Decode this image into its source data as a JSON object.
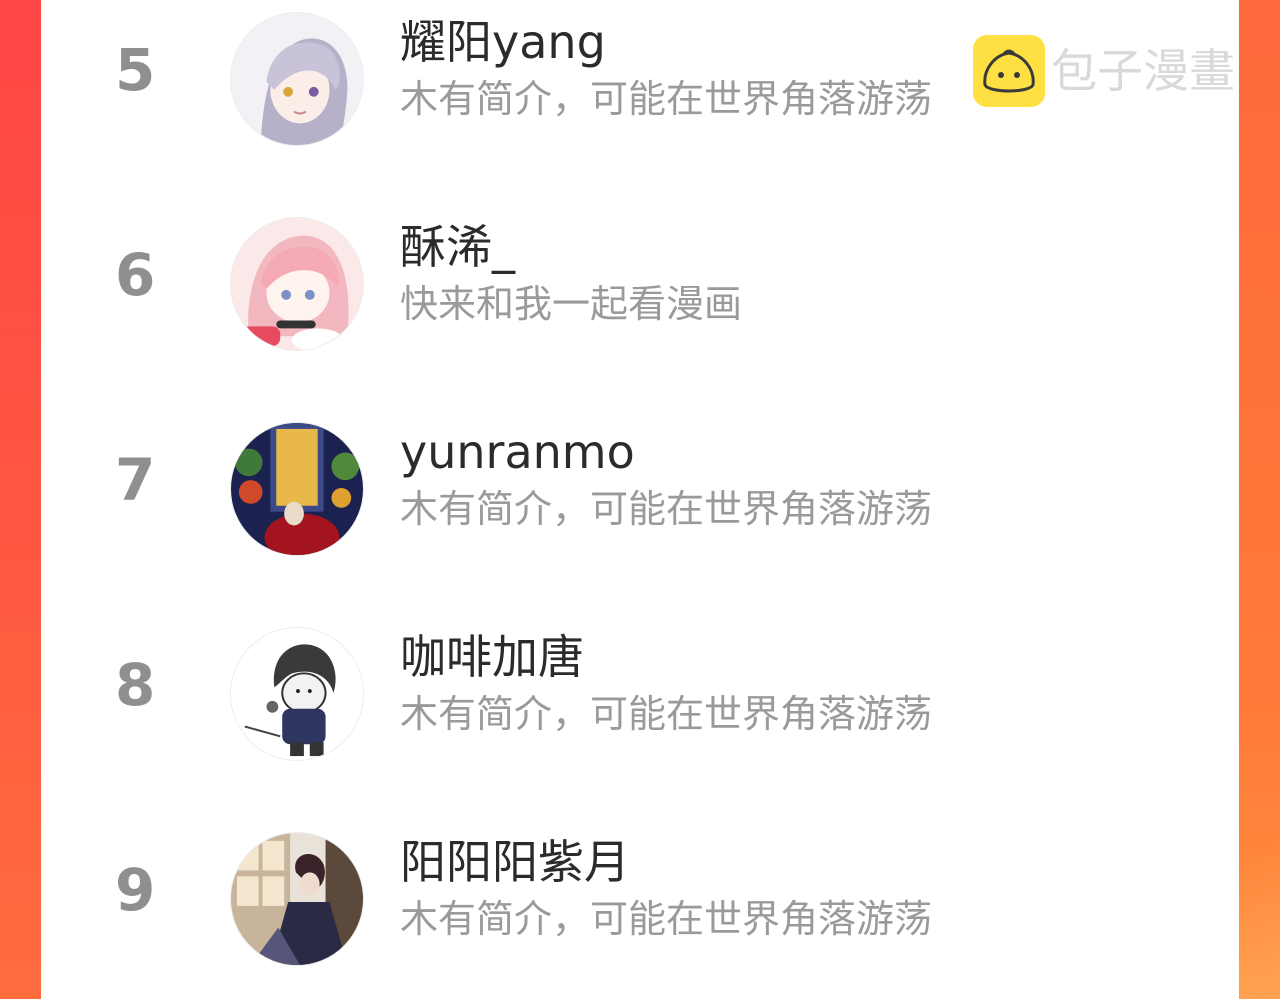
{
  "watermark": {
    "text": "包子漫畫",
    "logo_icon": "bun-logo-icon"
  },
  "colors": {
    "background_red": "#ff4a45",
    "background_orange": "#ff7a3a",
    "rank": "#8f8f8f",
    "name": "#2b2b2b",
    "bio": "#9a9a9a",
    "logo_yellow": "#ffe043"
  },
  "users": [
    {
      "rank": "5",
      "name": "耀阳yang",
      "bio": "木有简介，可能在世界角落游荡"
    },
    {
      "rank": "6",
      "name": "酥浠_",
      "bio": "快来和我一起看漫画"
    },
    {
      "rank": "7",
      "name": "yunranmo",
      "bio": "木有简介，可能在世界角落游荡"
    },
    {
      "rank": "8",
      "name": "咖啡加唐",
      "bio": "木有简介，可能在世界角落游荡"
    },
    {
      "rank": "9",
      "name": "阳阳阳紫月",
      "bio": "木有简介，可能在世界角落游荡"
    }
  ]
}
